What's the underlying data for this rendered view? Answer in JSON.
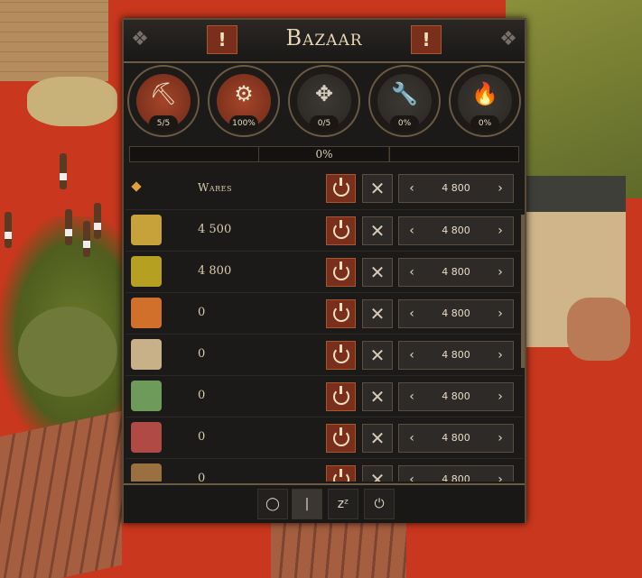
{
  "panel": {
    "title": "Bazaar",
    "alert_icon": "exclamation-icon",
    "alert_glyph": "!"
  },
  "stats": [
    {
      "icon": "worker-icon",
      "glyph": "⛏",
      "value": "5/5",
      "state": "active"
    },
    {
      "icon": "efficiency-gear-icon",
      "glyph": "⚙",
      "value": "100%",
      "state": "active"
    },
    {
      "icon": "compress-arrows-icon",
      "glyph": "✥",
      "value": "0/5",
      "state": "idle"
    },
    {
      "icon": "wrench-icon",
      "glyph": "🔧",
      "value": "0%",
      "state": "idle"
    },
    {
      "icon": "fire-icon",
      "glyph": "🔥",
      "value": "0%",
      "state": "idle"
    }
  ],
  "progress": {
    "label": "0%",
    "fraction": 0
  },
  "wares_header": {
    "label": "Wares",
    "limit": "4 800"
  },
  "wares": [
    {
      "icon": "wheat-icon",
      "color": "#c7a23a",
      "amount": "4 500",
      "limit": "4 800"
    },
    {
      "icon": "rope-coil-icon",
      "color": "#b6a021",
      "amount": "4 800",
      "limit": "4 800"
    },
    {
      "icon": "amphora-icon",
      "color": "#d0702a",
      "amount": "0",
      "limit": "4 800"
    },
    {
      "icon": "linen-cloth-icon",
      "color": "#c8b088",
      "amount": "0",
      "limit": "4 800"
    },
    {
      "icon": "papyrus-icon",
      "color": "#6e9a5a",
      "amount": "0",
      "limit": "4 800"
    },
    {
      "icon": "meat-icon",
      "color": "#b04a44",
      "amount": "0",
      "limit": "4 800"
    },
    {
      "icon": "chest-icon",
      "color": "#9a7040",
      "amount": "0",
      "limit": "4 800"
    }
  ],
  "controls": {
    "decrease": "‹",
    "increase": "›",
    "block": "✕"
  },
  "footer": {
    "buttons": [
      {
        "icon": "circle-icon",
        "glyph": "◯"
      },
      {
        "icon": "bar-icon",
        "glyph": "|"
      },
      {
        "icon": "sleep-icon",
        "glyph": "zᶻ"
      },
      {
        "icon": "power-icon",
        "glyph": "⏻"
      }
    ]
  }
}
